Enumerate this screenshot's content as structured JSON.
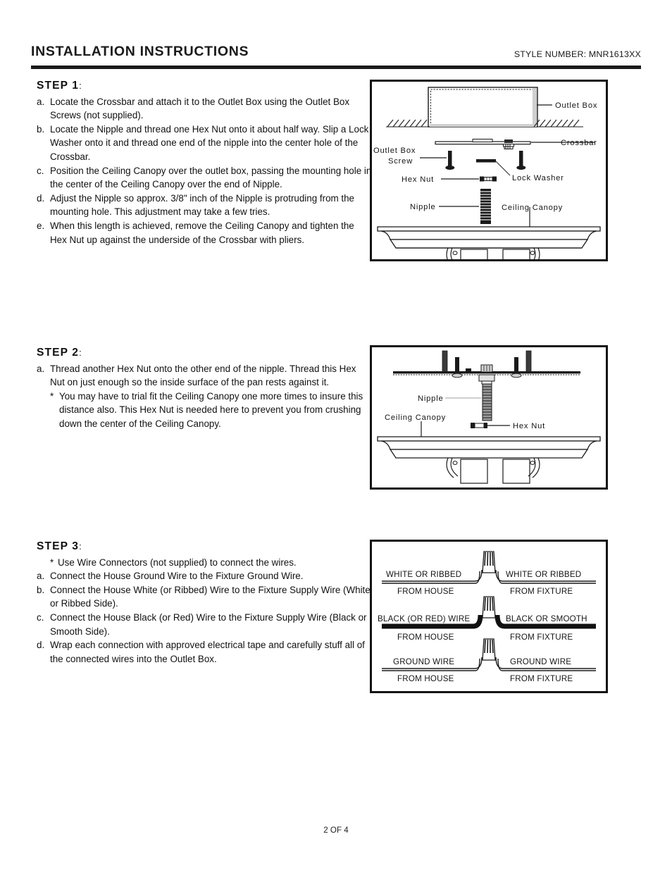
{
  "header": {
    "title": "INSTALLATION INSTRUCTIONS",
    "style_number": "STYLE NUMBER: MNR1613XX"
  },
  "footer": {
    "page": "2 OF 4"
  },
  "steps": [
    {
      "title": "STEP 1",
      "colon": ":",
      "items": [
        {
          "marker": "a.",
          "text": "Locate the Crossbar and attach it to the Outlet Box using the Outlet Box Screws (not supplied)."
        },
        {
          "marker": "b.",
          "text": "Locate the Nipple and thread one Hex Nut onto it about half way. Slip a Lock Washer onto it and thread one end of the nipple into the center hole of the Crossbar."
        },
        {
          "marker": "c.",
          "text": "Position the Ceiling Canopy over the outlet box, passing the mounting hole in the center of the Ceiling Canopy over the end of Nipple."
        },
        {
          "marker": "d.",
          "text": "Adjust the Nipple so approx. 3/8\" inch of the Nipple is protruding from the mounting hole. This adjustment may take a few tries."
        },
        {
          "marker": "e.",
          "text": "When this length is achieved, remove the Ceiling Canopy and tighten the Hex Nut up against the underside of the Crossbar with pliers."
        }
      ]
    },
    {
      "title": "STEP 2",
      "colon": ":",
      "items": [
        {
          "marker": "a.",
          "text": "Thread another Hex Nut onto the other end of the nipple.  Thread this Hex Nut on just enough so the inside surface of the pan rests against it."
        },
        {
          "marker": "*",
          "text": "You may have to trial fit the Ceiling Canopy one more times to insure this distance also. This Hex Nut is needed here to prevent you from crushing down the center of the Ceiling Canopy."
        }
      ]
    },
    {
      "title": "STEP 3",
      "colon": ":",
      "items": [
        {
          "marker": "*",
          "text": "Use Wire Connectors (not supplied) to connect the wires."
        },
        {
          "marker": "a.",
          "text": "Connect the House Ground Wire to the Fixture Ground Wire."
        },
        {
          "marker": "b.",
          "text": "Connect the House White (or Ribbed) Wire to the Fixture Supply Wire (White or Ribbed Side)."
        },
        {
          "marker": "c.",
          "text": "Connect the House Black (or Red) Wire to the Fixture Supply Wire (Black or Smooth Side)."
        },
        {
          "marker": "d.",
          "text": "Wrap each connection with approved electrical tape and carefully stuff all of the connected wires into the Outlet Box."
        }
      ]
    }
  ],
  "diagram1": {
    "labels": {
      "outlet_box": "Outlet Box",
      "crossbar": "Crossbar",
      "outlet_box_screw_line1": "Outlet Box",
      "outlet_box_screw_line2": "Screw",
      "hex_nut": "Hex Nut",
      "lock_washer": "Lock Washer",
      "nipple": "Nipple",
      "ceiling_canopy": "Ceiling Canopy"
    }
  },
  "diagram2": {
    "labels": {
      "nipple": "Nipple",
      "ceiling_canopy": "Ceiling Canopy",
      "hex_nut": "Hex Nut"
    }
  },
  "diagram3": {
    "rows": [
      {
        "left_top": "WHITE OR RIBBED",
        "left_bottom": "FROM HOUSE",
        "right_top": "WHITE OR RIBBED",
        "right_bottom": "FROM FIXTURE",
        "wire_color": "#ffffff"
      },
      {
        "left_top": "BLACK (OR RED) WIRE",
        "left_bottom": "FROM HOUSE",
        "right_top": "BLACK OR SMOOTH",
        "right_bottom": "FROM FIXTURE",
        "wire_color": "#111111"
      },
      {
        "left_top": "GROUND WIRE",
        "left_bottom": "FROM HOUSE",
        "right_top": "GROUND WIRE",
        "right_bottom": "FROM FIXTURE",
        "wire_color": "#ffffff"
      }
    ]
  },
  "colors": {
    "ink": "#1a1a1a",
    "paper": "#ffffff",
    "black_wire": "#111111"
  }
}
